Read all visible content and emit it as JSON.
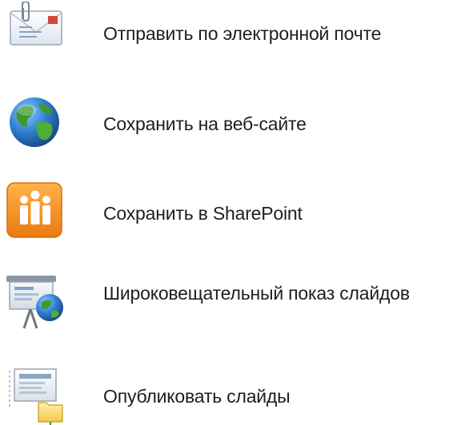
{
  "share_options": {
    "items": [
      {
        "label": "Отправить по электронной почте",
        "icon": "email-envelope-icon"
      },
      {
        "label": "Сохранить на веб-сайте",
        "icon": "globe-icon"
      },
      {
        "label": "Сохранить в SharePoint",
        "icon": "sharepoint-icon"
      },
      {
        "label": "Широковещательный показ слайдов",
        "icon": "broadcast-presentation-icon"
      },
      {
        "label": "Опубликовать слайды",
        "icon": "publish-slides-icon"
      }
    ]
  },
  "colors": {
    "text": "#1e1e1e",
    "sharepoint_orange": "#f28a1a",
    "globe_blue": "#2f7fd0",
    "globe_green": "#3c9a2a",
    "email_red": "#d6453a"
  }
}
